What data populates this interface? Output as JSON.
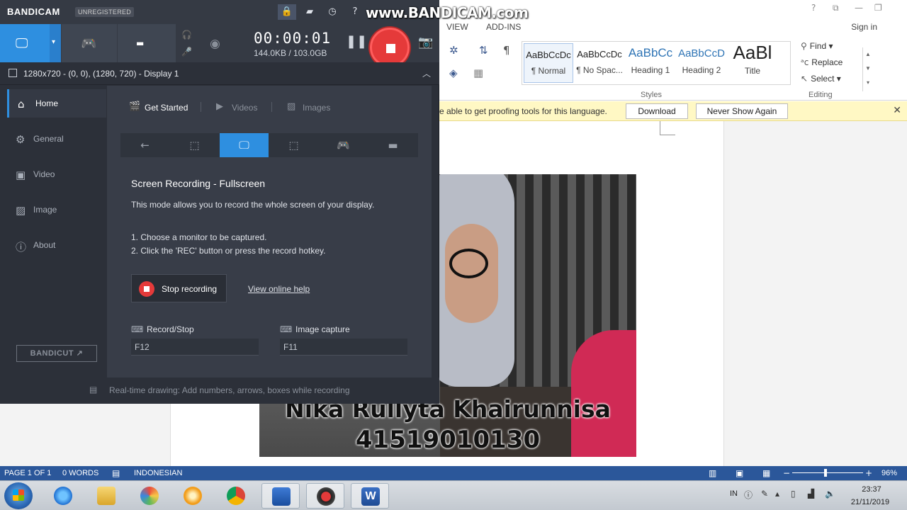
{
  "word": {
    "ribbon_tabs": [
      "VIEW",
      "ADD-INS"
    ],
    "signin": "Sign in",
    "styles": [
      {
        "sample": "AaBbCcDc",
        "name": "¶ Normal"
      },
      {
        "sample": "AaBbCcDc",
        "name": "¶ No Spac..."
      },
      {
        "sample": "AaBbCc",
        "name": "Heading 1"
      },
      {
        "sample": "AaBbCcD",
        "name": "Heading 2"
      },
      {
        "sample": "AaBl",
        "name": "Title"
      }
    ],
    "styles_group_label": "Styles",
    "editing_group_label": "Editing",
    "editing": {
      "find": "Find",
      "replace": "Replace",
      "select": "Select"
    },
    "message_bar": {
      "text": "e able to get proofing tools for this language.",
      "download": "Download",
      "never_show": "Never Show Again"
    },
    "photo_caption": {
      "name": "Nika Rullyta Khairunnisa",
      "id": "41519010130"
    },
    "status": {
      "page": "PAGE 1 OF 1",
      "words": "0 WORDS",
      "language": "INDONESIAN",
      "zoom": "96%"
    },
    "accent_color": "#2b579a"
  },
  "taskbar": {
    "apps": [
      "internet-explorer",
      "file-explorer",
      "paint",
      "settings",
      "chrome",
      "bandicam-shield",
      "bandicam-rec",
      "word"
    ],
    "tray_lang": "IN",
    "time": "23:37",
    "date": "21/11/2019"
  },
  "bandicam": {
    "logo": "BANDICAM",
    "unregistered": "UNREGISTERED",
    "watermark": "www.BANDICAM.com",
    "timer": "00:00:01",
    "filesize": "144.0KB / 103.0GB",
    "info": "1280x720 - (0, 0), (1280, 720) - Display 1",
    "sidebar": [
      "Home",
      "General",
      "Video",
      "Image",
      "About"
    ],
    "bandicut": "BANDICUT ↗",
    "top_tabs": [
      "Get Started",
      "Videos",
      "Images"
    ],
    "mode_title": "Screen Recording - Fullscreen",
    "mode_desc": "This mode allows you to record the whole screen of your display.",
    "step1": "1. Choose a monitor to be captured.",
    "step2": "2. Click the 'REC' button or press the record hotkey.",
    "stop_label": "Stop recording",
    "help_link": "View online help",
    "hotkeys": {
      "record_label": "Record/Stop",
      "record_value": "F12",
      "image_label": "Image capture",
      "image_value": "F11"
    },
    "footer": "Real-time drawing: Add numbers, arrows, boxes while recording",
    "accent_color": "#2e8fe0",
    "rec_color": "#e53a3a"
  }
}
